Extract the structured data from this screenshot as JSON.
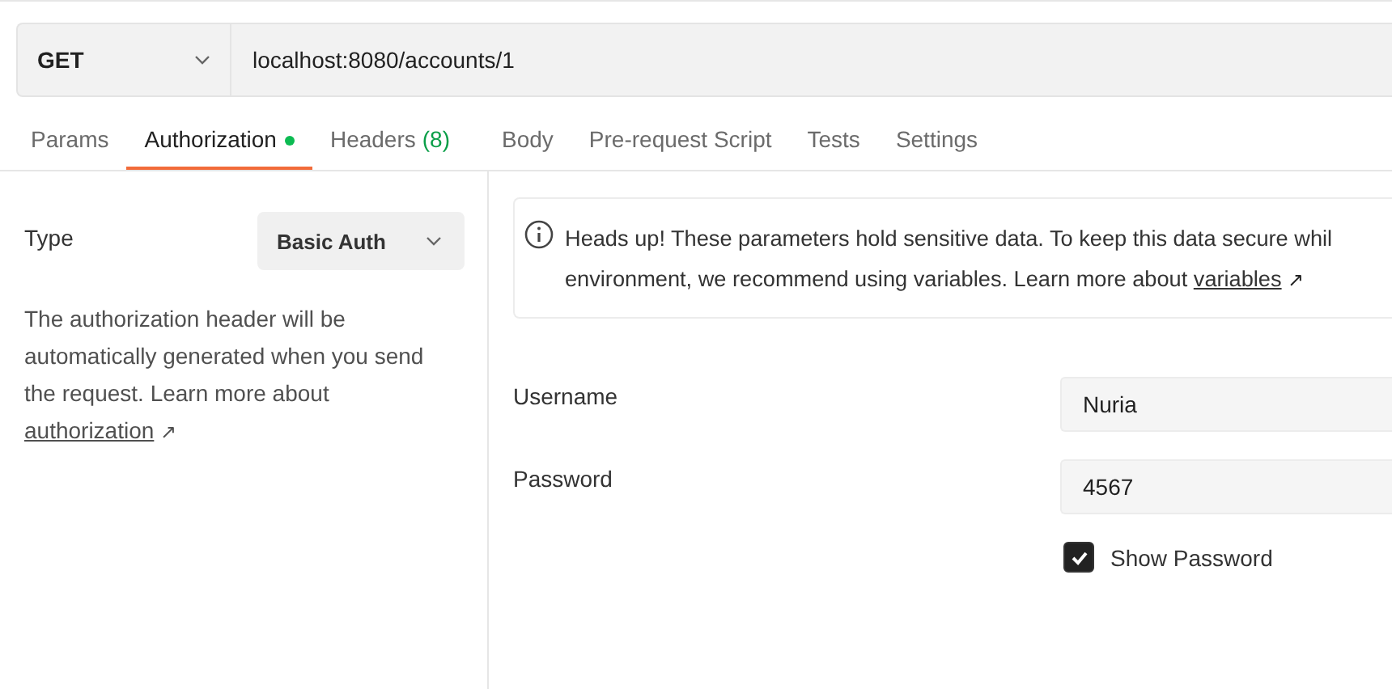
{
  "request": {
    "method": "GET",
    "url": "localhost:8080/accounts/1"
  },
  "tabs": [
    {
      "label": "Params",
      "selected": false,
      "indicator": false
    },
    {
      "label": "Authorization",
      "selected": true,
      "indicator": true
    },
    {
      "label": "Headers",
      "count": "(8)",
      "selected": false,
      "indicator": false
    },
    {
      "label": "Body",
      "selected": false,
      "indicator": false
    },
    {
      "label": "Pre-request Script",
      "selected": false,
      "indicator": false
    },
    {
      "label": "Tests",
      "selected": false,
      "indicator": false
    },
    {
      "label": "Settings",
      "selected": false,
      "indicator": false
    }
  ],
  "auth": {
    "type_label": "Type",
    "type_value": "Basic Auth",
    "description": "The authorization header will be automatically generated when you send the request. Learn more about",
    "link": "authorization",
    "link_arrow": "↗"
  },
  "notice": {
    "line_1": "Heads up! These parameters hold sensitive data. To keep this data secure whil",
    "line_2": "environment, we recommend using variables. Learn more about",
    "link": "variables",
    "link_arrow": "↗"
  },
  "fields": [
    {
      "label": "Username",
      "value": "Nuria"
    },
    {
      "label": "Password",
      "value": "4567"
    }
  ],
  "show_password": {
    "label": "Show Password",
    "checked": true
  }
}
